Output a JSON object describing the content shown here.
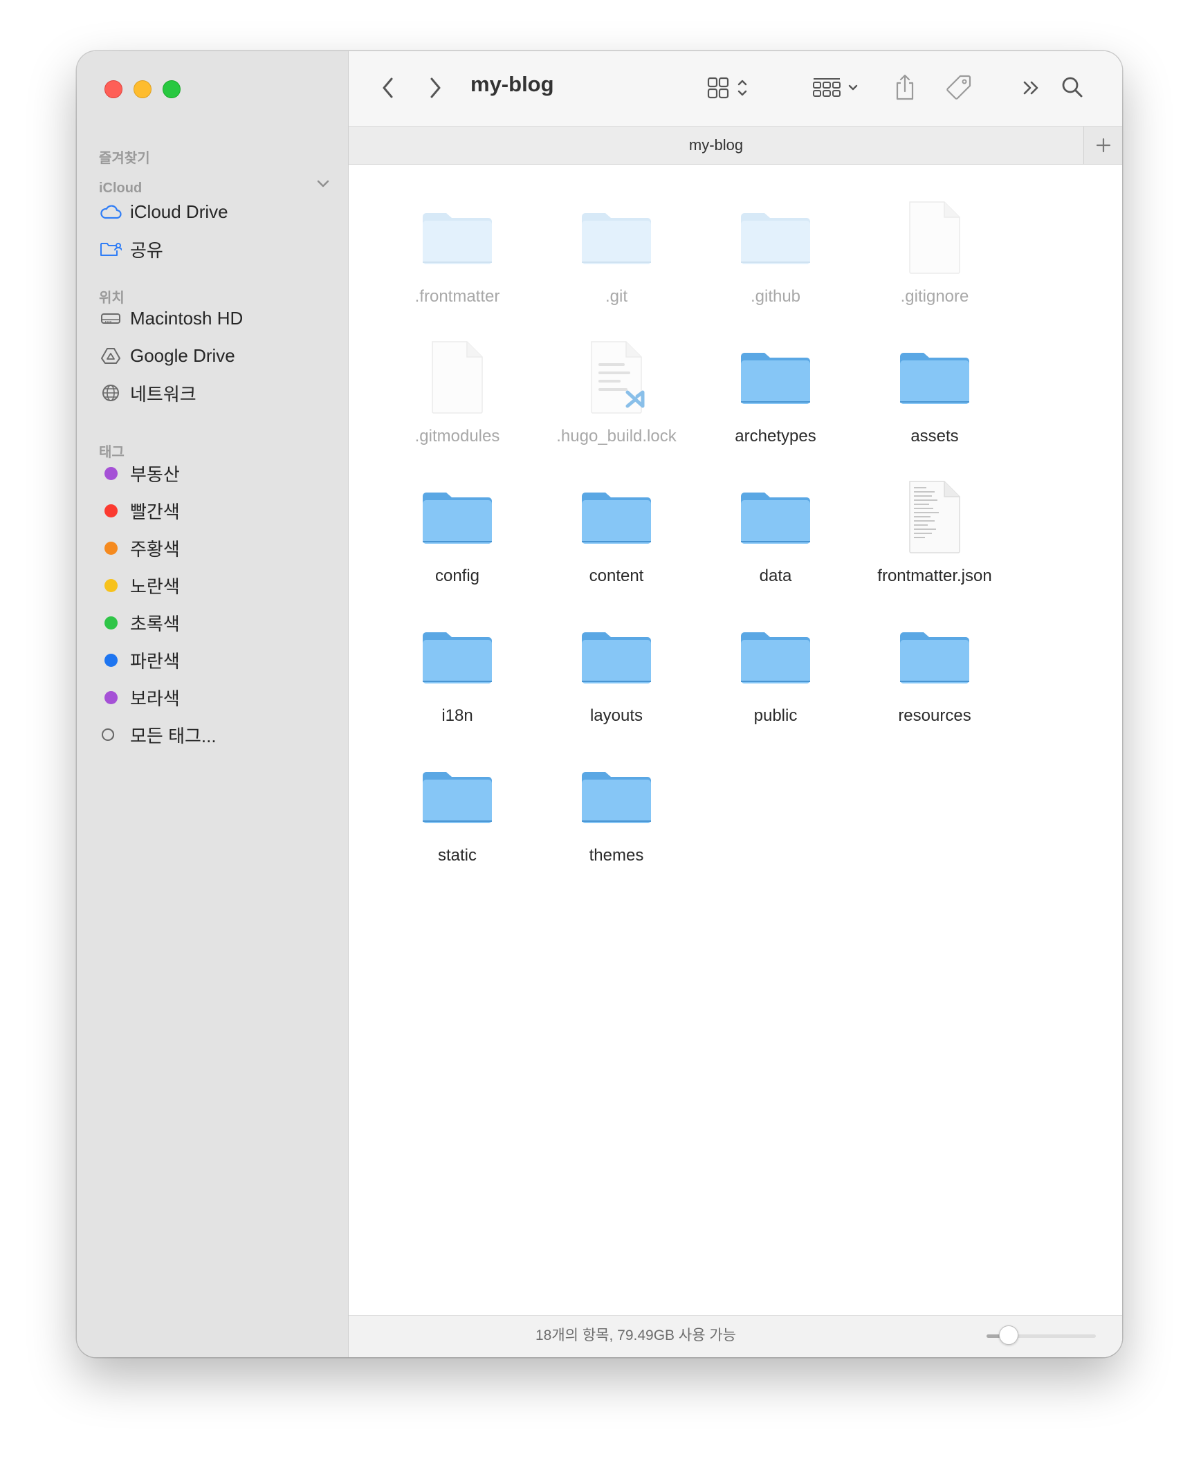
{
  "window": {
    "title": "my-blog",
    "tab_label": "my-blog",
    "traffic_lights": {
      "close": "#fe5f57",
      "minimize": "#febc2e",
      "zoom": "#28c840"
    }
  },
  "sidebar": {
    "favorites_header": "즐겨찾기",
    "icloud_header": "iCloud",
    "icloud_items": [
      {
        "label": "iCloud Drive",
        "icon": "cloud-icon"
      },
      {
        "label": "공유",
        "icon": "shared-folder-icon"
      }
    ],
    "locations_header": "위치",
    "location_items": [
      {
        "label": "Macintosh HD",
        "icon": "hard-drive-icon"
      },
      {
        "label": "Google Drive",
        "icon": "google-drive-icon"
      },
      {
        "label": "네트워크",
        "icon": "network-globe-icon"
      }
    ],
    "tags_header": "태그",
    "tags": [
      {
        "label": "부동산",
        "color": "#a551d6"
      },
      {
        "label": "빨간색",
        "color": "#fb3a30"
      },
      {
        "label": "주황색",
        "color": "#f58a1f"
      },
      {
        "label": "노란색",
        "color": "#f7c21c"
      },
      {
        "label": "초록색",
        "color": "#2fc548"
      },
      {
        "label": "파란색",
        "color": "#1e75f0"
      },
      {
        "label": "보라색",
        "color": "#a551d6"
      }
    ],
    "all_tags_label": "모든 태그..."
  },
  "files": [
    {
      "name": ".frontmatter",
      "kind": "folder",
      "hidden": true
    },
    {
      "name": ".git",
      "kind": "folder",
      "hidden": true
    },
    {
      "name": ".github",
      "kind": "folder",
      "hidden": true
    },
    {
      "name": ".gitignore",
      "kind": "document",
      "hidden": true
    },
    {
      "name": ".gitmodules",
      "kind": "document",
      "hidden": true
    },
    {
      "name": ".hugo_build.lock",
      "kind": "vscode-document",
      "hidden": true
    },
    {
      "name": "archetypes",
      "kind": "folder",
      "hidden": false
    },
    {
      "name": "assets",
      "kind": "folder",
      "hidden": false
    },
    {
      "name": "config",
      "kind": "folder",
      "hidden": false
    },
    {
      "name": "content",
      "kind": "folder",
      "hidden": false
    },
    {
      "name": "data",
      "kind": "folder",
      "hidden": false
    },
    {
      "name": "frontmatter.json",
      "kind": "json-document",
      "hidden": false
    },
    {
      "name": "i18n",
      "kind": "folder",
      "hidden": false
    },
    {
      "name": "layouts",
      "kind": "folder",
      "hidden": false
    },
    {
      "name": "public",
      "kind": "folder",
      "hidden": false
    },
    {
      "name": "resources",
      "kind": "folder",
      "hidden": false
    },
    {
      "name": "static",
      "kind": "folder",
      "hidden": false
    },
    {
      "name": "themes",
      "kind": "folder",
      "hidden": false
    }
  ],
  "status": {
    "text": "18개의 항목, 79.49GB 사용 가능",
    "icon_size_slider": 0.2
  }
}
